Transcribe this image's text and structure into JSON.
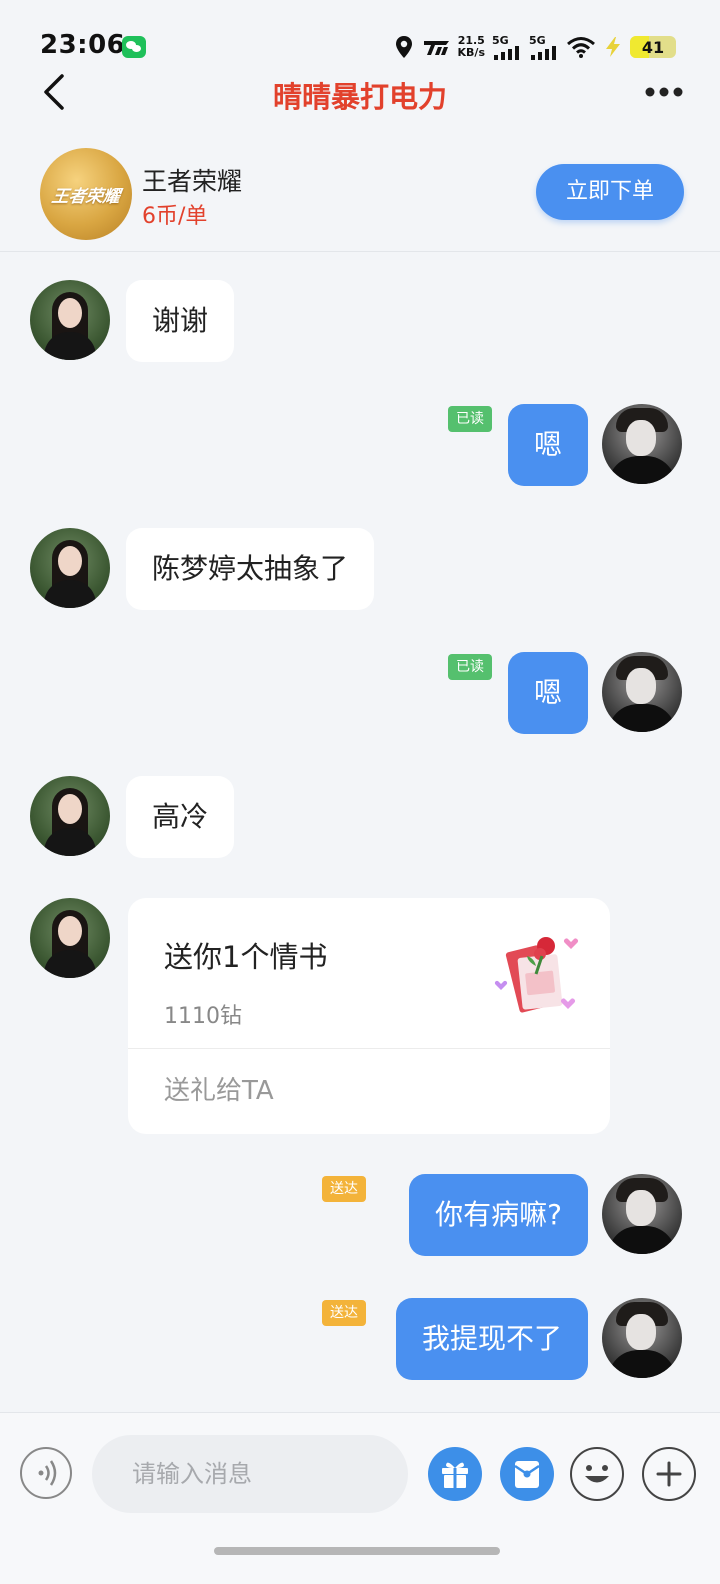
{
  "status_bar": {
    "time": "23:06",
    "speed_value": "21.5",
    "speed_unit": "KB/s",
    "sim1_type": "5G",
    "sim2_type": "5G",
    "battery": "41"
  },
  "header": {
    "title": "晴晴暴打电力"
  },
  "product": {
    "logo_text": "王者荣耀",
    "name": "王者荣耀",
    "price": "6币/单",
    "order_label": "立即下单"
  },
  "messages": [
    {
      "from": "other",
      "text": "谢谢"
    },
    {
      "from": "self",
      "text": "嗯",
      "receipt": "已读"
    },
    {
      "from": "other",
      "text": "陈梦婷太抽象了"
    },
    {
      "from": "self",
      "text": "嗯",
      "receipt": "已读"
    },
    {
      "from": "other",
      "text": "高冷"
    },
    {
      "from": "self",
      "text": "你有病嘛?",
      "receipt": "送达"
    },
    {
      "from": "self",
      "text": "我提现不了",
      "receipt": "送达"
    }
  ],
  "gift": {
    "title": "送你1个情书",
    "price": "1110钻",
    "action": "送礼给TA"
  },
  "input": {
    "placeholder": "请输入消息"
  },
  "colors": {
    "accent_blue": "#4a90f0",
    "title_red": "#e2412c",
    "read_green": "#55c06e",
    "sent_orange": "#f3b33a",
    "background": "#f3f5f8"
  }
}
